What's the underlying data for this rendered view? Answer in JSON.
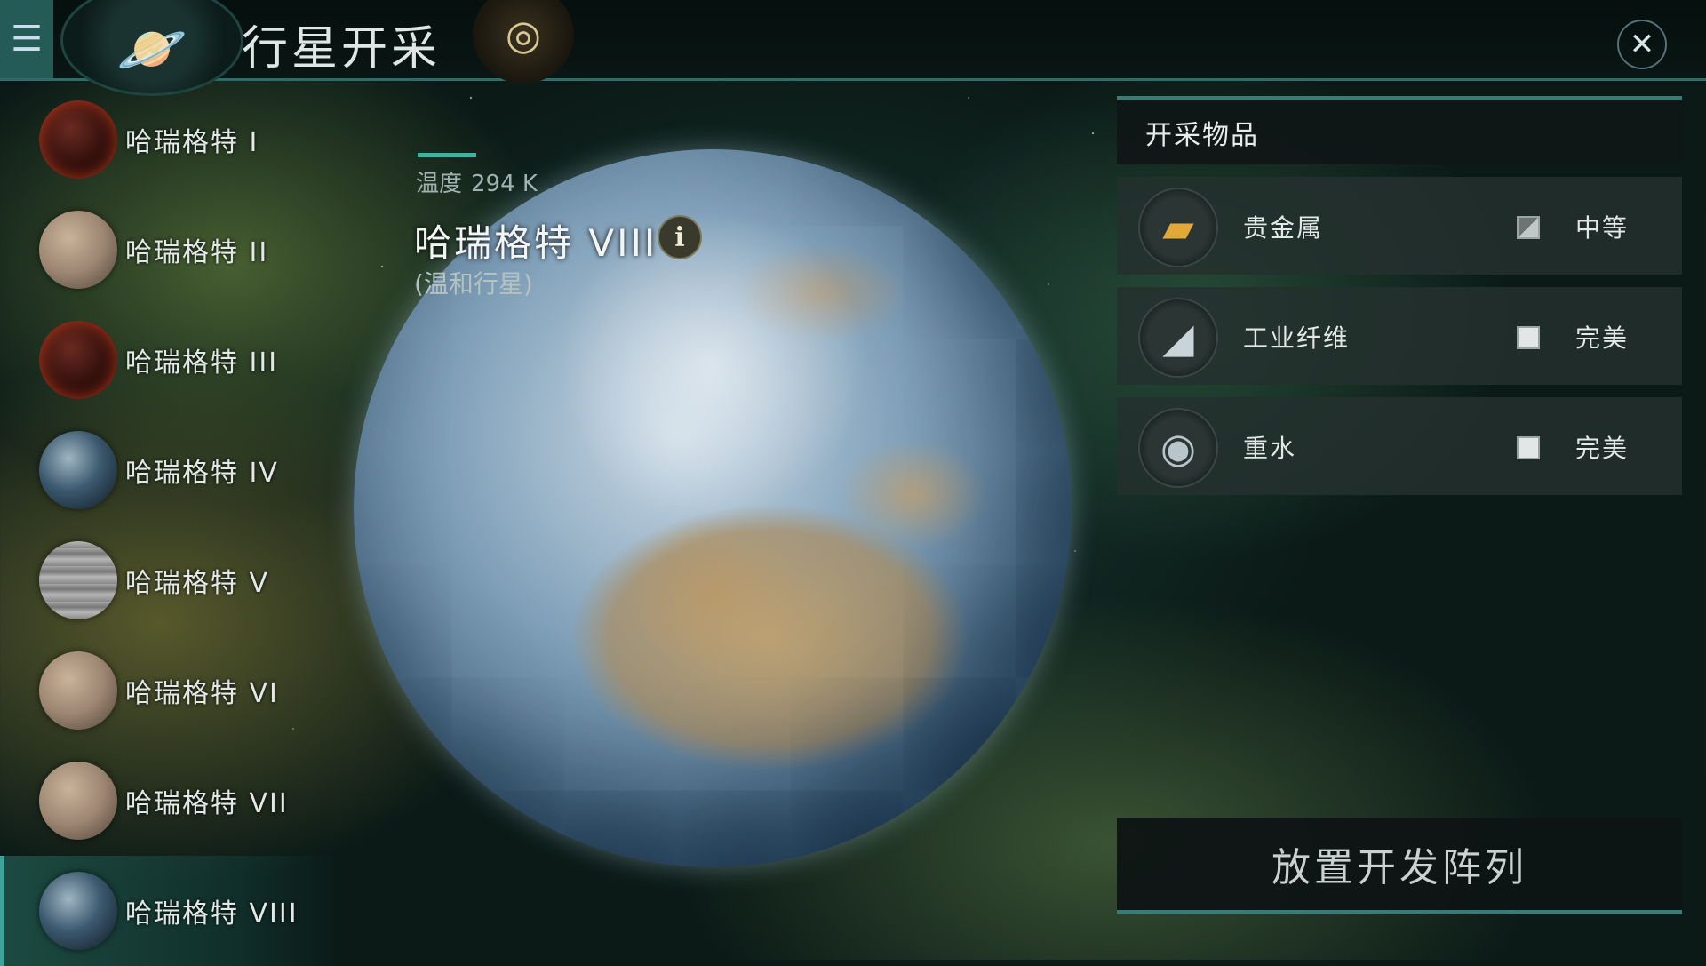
{
  "header": {
    "menu_icon": "menu-icon",
    "planet_icon": "planet-icon",
    "title": "行星开采",
    "scan_icon": "target-icon",
    "close_icon": "close-icon"
  },
  "planets": [
    {
      "label": "哈瑞格特 I",
      "type": "lava"
    },
    {
      "label": "哈瑞格特 II",
      "type": "barren"
    },
    {
      "label": "哈瑞格特 III",
      "type": "lava"
    },
    {
      "label": "哈瑞格特 IV",
      "type": "earth"
    },
    {
      "label": "哈瑞格特 V",
      "type": "gas"
    },
    {
      "label": "哈瑞格特 VI",
      "type": "barren"
    },
    {
      "label": "哈瑞格特 VII",
      "type": "barren"
    },
    {
      "label": "哈瑞格特 VIII",
      "type": "earth",
      "selected": true
    }
  ],
  "selected_planet": {
    "temp_label": "温度",
    "temp_value": "294 K",
    "name": "哈瑞格特  VIII",
    "type": "(温和行星)",
    "info_icon": "info-icon"
  },
  "resources": {
    "title": "开采物品",
    "items": [
      {
        "name": "贵金属",
        "grade": "中等",
        "icon": "gold-bars-icon",
        "check": "partial"
      },
      {
        "name": "工业纤维",
        "grade": "完美",
        "icon": "fiber-roll-icon",
        "check": "full"
      },
      {
        "name": "重水",
        "grade": "完美",
        "icon": "heavy-water-icon",
        "check": "full"
      }
    ]
  },
  "deploy_button": "放置开发阵列",
  "colors": {
    "accent": "#3fa497",
    "panel_bg": "#101616",
    "gold": "#e3a936"
  }
}
